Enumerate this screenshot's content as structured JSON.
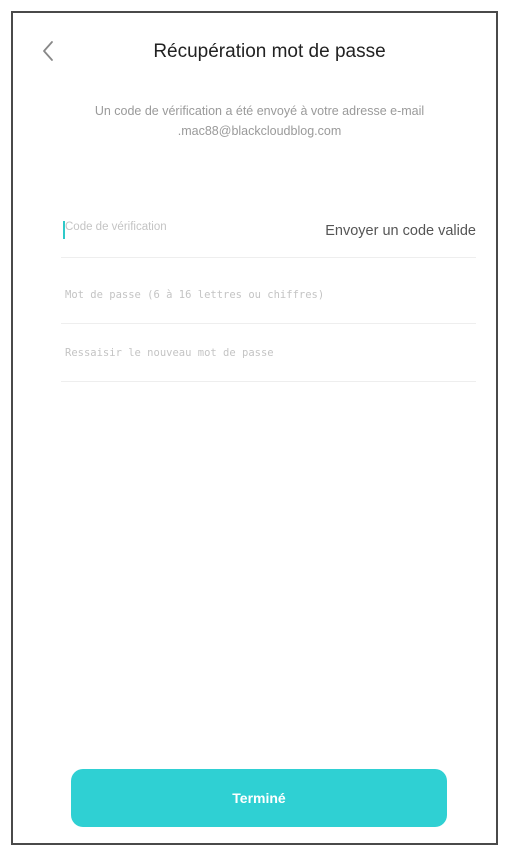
{
  "header": {
    "title": "Récupération mot de passe",
    "back_icon": "chevron-left-icon"
  },
  "info": {
    "message": "Un code de vérification a été envoyé à votre adresse e-mail .mac88@blackcloudblog.com"
  },
  "form": {
    "verification_code": {
      "value": "",
      "placeholder": "Code de vérification"
    },
    "send_code_label": "Envoyer un code valide",
    "new_password": {
      "value": "",
      "placeholder": "Mot de passe (6 à 16 lettres ou chiffres)"
    },
    "confirm_password": {
      "value": "",
      "placeholder": "Ressaisir le nouveau mot de passe"
    }
  },
  "footer": {
    "done_label": "Terminé"
  },
  "colors": {
    "accent": "#2fd0d3",
    "border": "#4a4a4a",
    "muted_text": "#9a9a9a"
  }
}
